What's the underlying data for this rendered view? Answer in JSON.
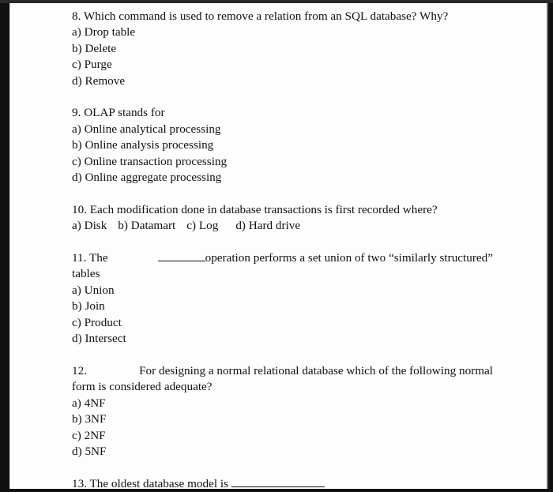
{
  "document": {
    "questions": [
      {
        "number": "8.",
        "text": "Which command is used to remove a relation from an SQL database? Why?",
        "options": [
          "a) Drop table",
          "b) Delete",
          "c) Purge",
          "d) Remove"
        ]
      },
      {
        "number": "9.",
        "text": "OLAP stands for",
        "options": [
          "a) Online analytical processing",
          "b) Online analysis processing",
          "c) Online transaction processing",
          "d) Online aggregate processing"
        ]
      },
      {
        "number": "10.",
        "text": "Each modification done in database transactions is first recorded where?",
        "options": [
          "a) Disk",
          "b) Datamart",
          "c) Log",
          "d) Hard drive"
        ]
      },
      {
        "number": "11.",
        "text_before_blank": "The",
        "text_after_blank": "operation performs a set union of two “similarly structured”",
        "text_continued": "tables",
        "options": [
          "a) Union",
          "b) Join",
          "c) Product",
          "d) Intersect"
        ]
      },
      {
        "number": "12.",
        "text_line1": "For designing a normal relational database which of the following normal",
        "text_line2": "form is considered adequate?",
        "options": [
          "a) 4NF",
          "b) 3NF",
          "c) 2NF",
          "d) 5NF"
        ]
      },
      {
        "number": "13.",
        "text": "The oldest database model is"
      }
    ]
  }
}
